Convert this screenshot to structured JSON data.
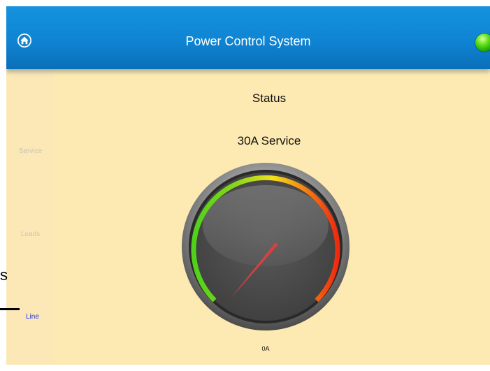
{
  "header": {
    "title": "Power Control System",
    "home_icon": "home-icon",
    "status_indicator": "green-led-indicator",
    "status_color": "#3cc80c"
  },
  "sidebar": {
    "items": [
      {
        "label": "Service",
        "active": false
      },
      {
        "label": "Loads",
        "active": false
      },
      {
        "label": "Line",
        "active": true
      }
    ]
  },
  "main": {
    "title": "Status",
    "subtitle": "30A Service",
    "gauge": {
      "readout": "0A",
      "needle_value_fraction": 0.0,
      "colors": {
        "green": "#4fd11a",
        "yellow": "#f2e117",
        "orange": "#f58a12",
        "red": "#ee2a0f",
        "needle": "#c02a2a"
      }
    }
  },
  "edge_artifact": {
    "char": "s"
  },
  "colors": {
    "header_blue": "#1493dd",
    "background": "#fdeab2",
    "active_link": "#2432e0"
  }
}
